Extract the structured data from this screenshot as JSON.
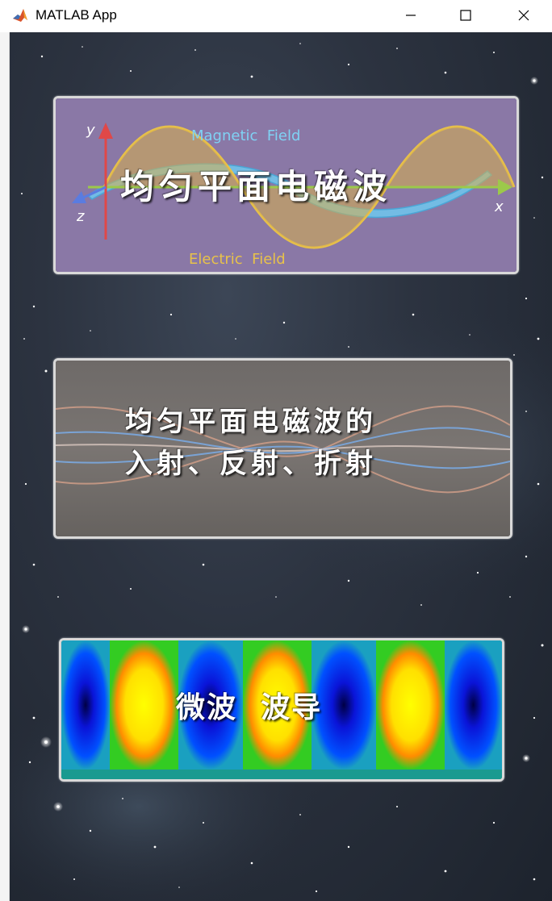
{
  "window": {
    "title": "MATLAB App",
    "icon": "matlab-logo-icon",
    "controls": [
      "minimize-icon",
      "maximize-icon",
      "close-icon"
    ]
  },
  "cards": {
    "plane_wave": {
      "label": "均匀平面电磁波",
      "diagram": {
        "y_axis": "y",
        "z_axis": "z",
        "x_axis": "x",
        "magnetic": "Magnetic  Field",
        "electric": "Electric  Field"
      }
    },
    "incidence": {
      "line1": "均匀平面电磁波的",
      "line2": "入射、反射、折射"
    },
    "waveguide": {
      "label": "微波  波导"
    }
  },
  "colors": {
    "card1_bg": "#8a78a6",
    "card2_bg": "#6f6a66",
    "magnetic": "#6ec8ee",
    "electric": "#e8c24a",
    "axis_x": "#9cc94a",
    "axis_y": "#e04848",
    "axis_z": "#5a7ce0"
  }
}
